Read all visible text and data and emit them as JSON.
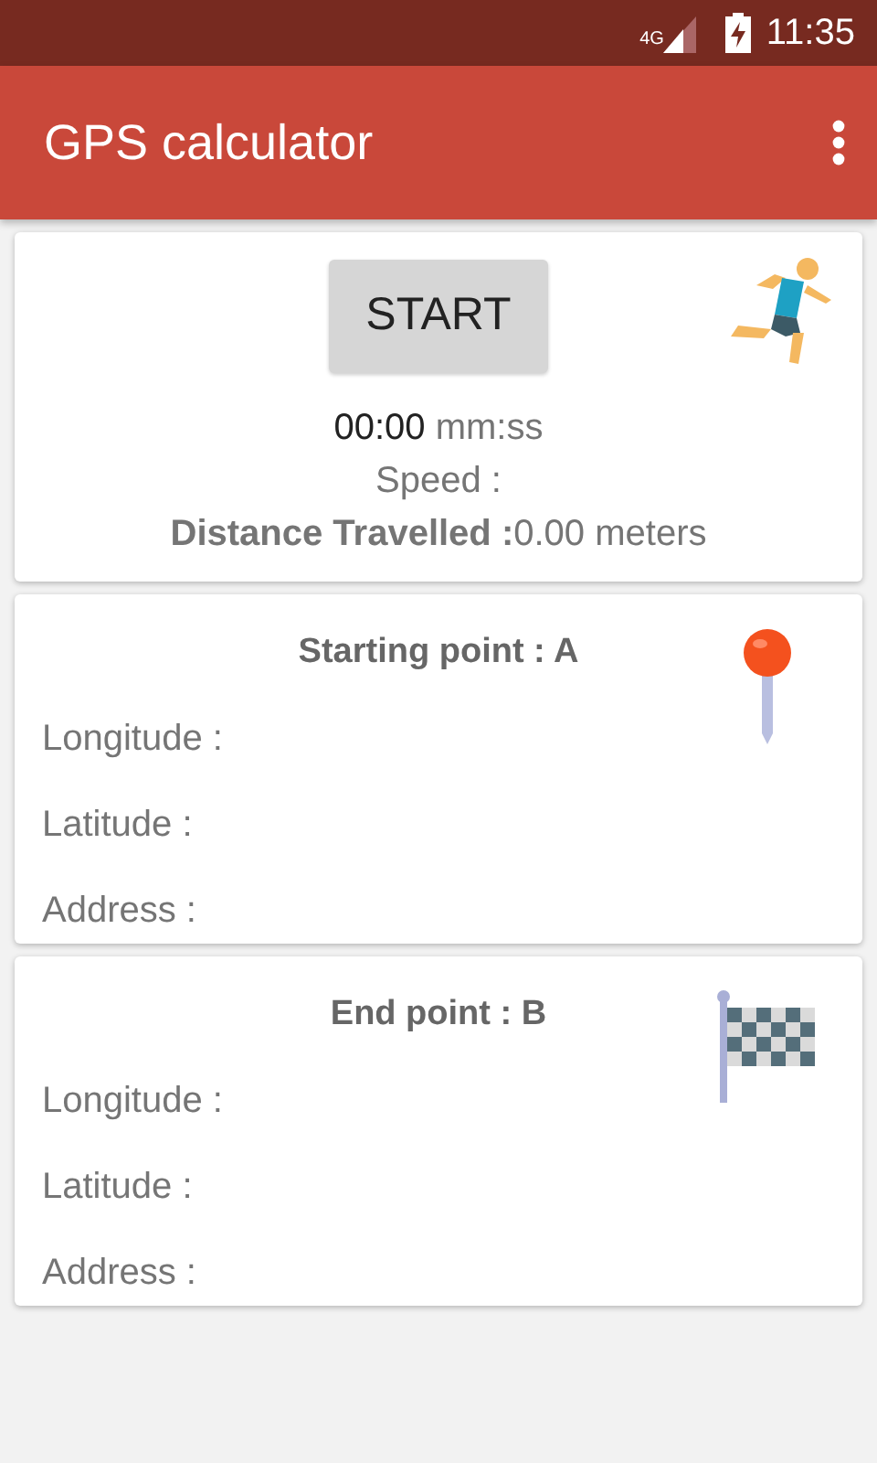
{
  "status_bar": {
    "network": "4G",
    "time": "11:35"
  },
  "app_bar": {
    "title": "GPS calculator"
  },
  "tracker": {
    "button": "START",
    "time": "00:00",
    "time_unit": "mm:ss",
    "speed_label": "Speed :",
    "distance_label": "Distance Travelled :",
    "distance_value": "0.00 meters"
  },
  "points": [
    {
      "kind": "start",
      "title": "Starting point : A",
      "fields": [
        "Longitude :",
        "Latitude :",
        "Address :"
      ]
    },
    {
      "kind": "end",
      "title": "End point : B",
      "fields": [
        "Longitude :",
        "Latitude :",
        "Address :"
      ]
    }
  ]
}
